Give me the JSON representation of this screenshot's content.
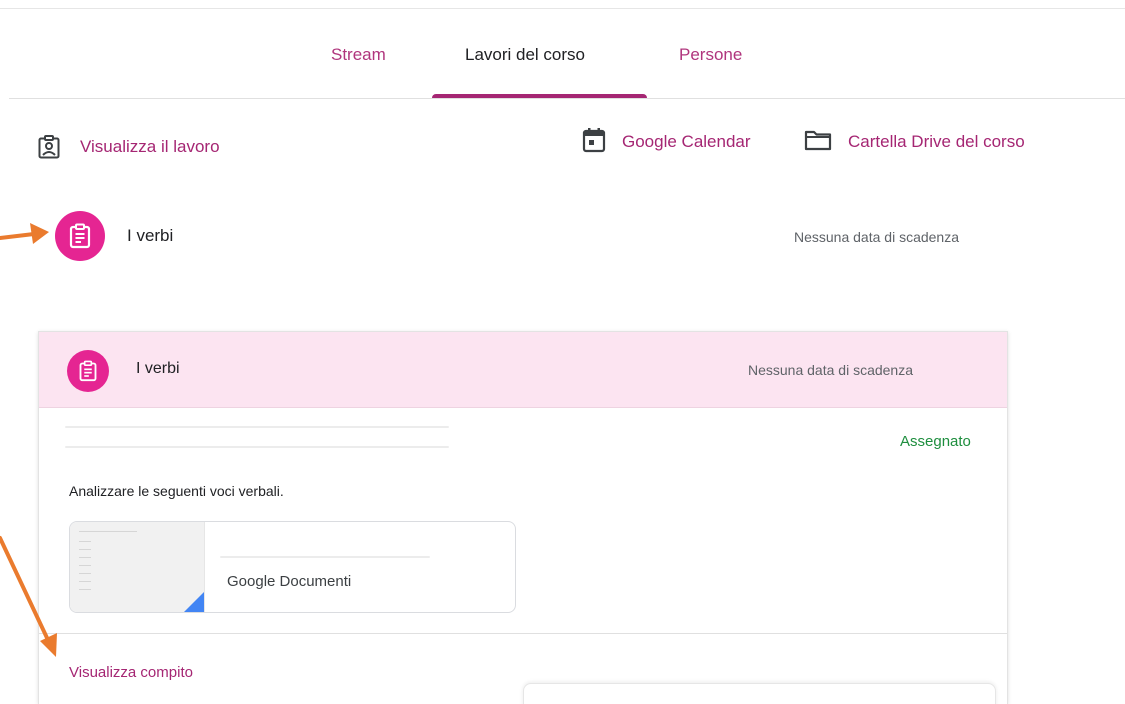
{
  "tabs": [
    {
      "label": "Stream"
    },
    {
      "label": "Lavori del corso"
    },
    {
      "label": "Persone"
    }
  ],
  "actions": {
    "view_work": "Visualizza il lavoro",
    "calendar": "Google Calendar",
    "drive_folder": "Cartella Drive del corso"
  },
  "assignment_row": {
    "title": "I verbi",
    "due": "Nessuna data di scadenza"
  },
  "card": {
    "title": "I verbi",
    "due": "Nessuna data di scadenza",
    "status": "Assegnato",
    "description": "Analizzare le seguenti voci verbali.",
    "attachment": {
      "type": "Google Documenti"
    },
    "view_link": "Visualizza compito"
  },
  "colors": {
    "accent": "#a52673",
    "avatar": "#e52592",
    "card_header": "#fce4f1",
    "status_green": "#1e8e3e",
    "annotation_arrow": "#ea7b2e"
  },
  "icons": [
    "assignment-icon",
    "calendar-icon",
    "folder-icon",
    "view-work-icon",
    "arrow-annotation"
  ]
}
